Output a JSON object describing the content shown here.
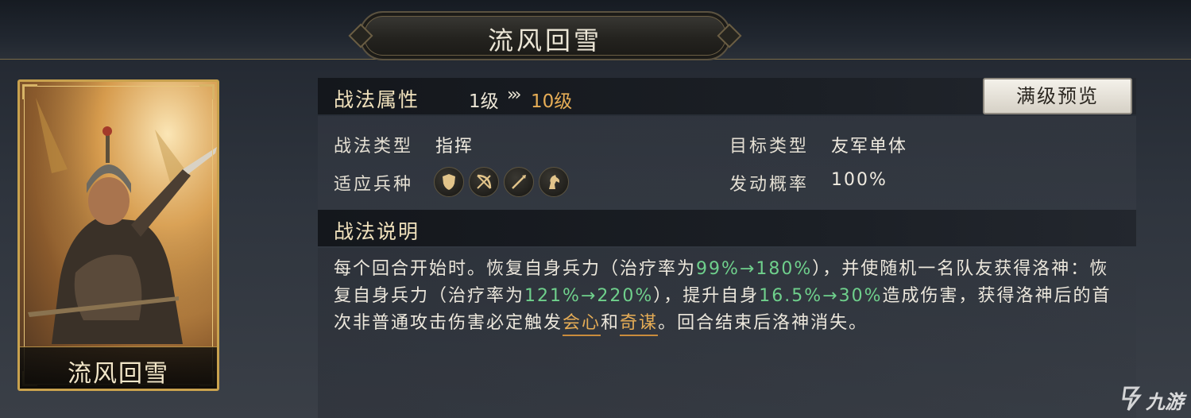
{
  "title": "流风回雪",
  "card": {
    "name": "流风回雪"
  },
  "attributes_header": {
    "label": "战法属性",
    "level_from": "1级",
    "level_arrow": "»",
    "level_to": "10级",
    "max_preview_label": "满级预览"
  },
  "attributes": {
    "tactic_type_label": "战法类型",
    "tactic_type_value": "指挥",
    "target_type_label": "目标类型",
    "target_type_value": "友军单体",
    "troop_type_label": "适应兵种",
    "troop_icons": [
      "shield-icon",
      "bow-icon",
      "spear-icon",
      "horse-icon"
    ],
    "trigger_rate_label": "发动概率",
    "trigger_rate_value": "100%"
  },
  "description_header": {
    "label": "战法说明"
  },
  "description": {
    "p1": "每个回合开始时。恢复自身兵力（治疗率为",
    "v1": "99%→180%",
    "p2": "），并使随机一名队友获得洛神：恢复自身兵力（治疗率为",
    "v2": "121%→220%",
    "p3": "），提升自身",
    "v3": "16.5%→30%",
    "p4": "造成伤害，获得洛神后的首次非普通攻击伤害必定触发",
    "kw1": "会心",
    "p5": "和",
    "kw2": "奇谋",
    "p6": "。回合结束后洛神消失。"
  },
  "watermark": {
    "text": "九游"
  },
  "colors": {
    "accent_gold": "#e6ad56",
    "highlight_green": "#6fd08c",
    "card_border": "#c9a24e"
  }
}
